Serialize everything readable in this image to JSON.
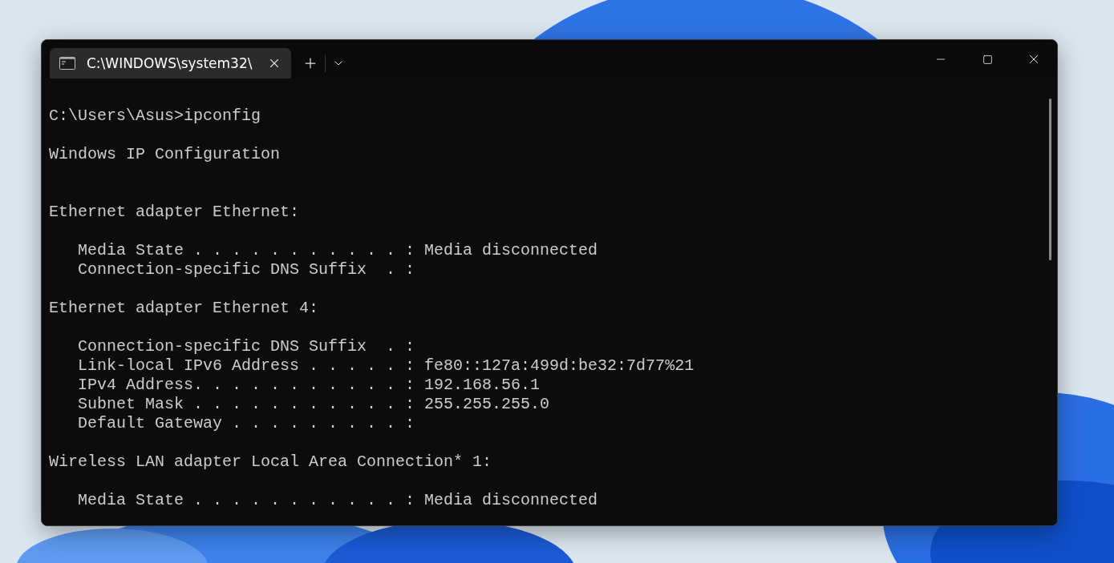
{
  "window": {
    "tab": {
      "title": "C:\\WINDOWS\\system32\\",
      "selected": true
    }
  },
  "terminal": {
    "lines": [
      {
        "kind": "text",
        "text": "C:\\Users\\Asus>ipconfig"
      },
      {
        "kind": "blank"
      },
      {
        "kind": "text",
        "text": "Windows IP Configuration"
      },
      {
        "kind": "blank"
      },
      {
        "kind": "blank"
      },
      {
        "kind": "text",
        "text": "Ethernet adapter Ethernet:"
      },
      {
        "kind": "blank"
      },
      {
        "kind": "text",
        "text": "   Media State . . . . . . . . . . . : Media disconnected"
      },
      {
        "kind": "text",
        "text": "   Connection-specific DNS Suffix  . :"
      },
      {
        "kind": "blank"
      },
      {
        "kind": "text",
        "text": "Ethernet adapter Ethernet 4:"
      },
      {
        "kind": "blank"
      },
      {
        "kind": "text",
        "text": "   Connection-specific DNS Suffix  . :"
      },
      {
        "kind": "text",
        "text": "   Link-local IPv6 Address . . . . . : fe80::127a:499d:be32:7d77%21"
      },
      {
        "kind": "text",
        "text": "   IPv4 Address. . . . . . . . . . . : 192.168.56.1"
      },
      {
        "kind": "text",
        "text": "   Subnet Mask . . . . . . . . . . . : 255.255.255.0"
      },
      {
        "kind": "text",
        "text": "   Default Gateway . . . . . . . . . :"
      },
      {
        "kind": "blank"
      },
      {
        "kind": "text",
        "text": "Wireless LAN adapter Local Area Connection* 1:"
      },
      {
        "kind": "blank"
      },
      {
        "kind": "text",
        "text": "   Media State . . . . . . . . . . . : Media disconnected"
      }
    ]
  }
}
